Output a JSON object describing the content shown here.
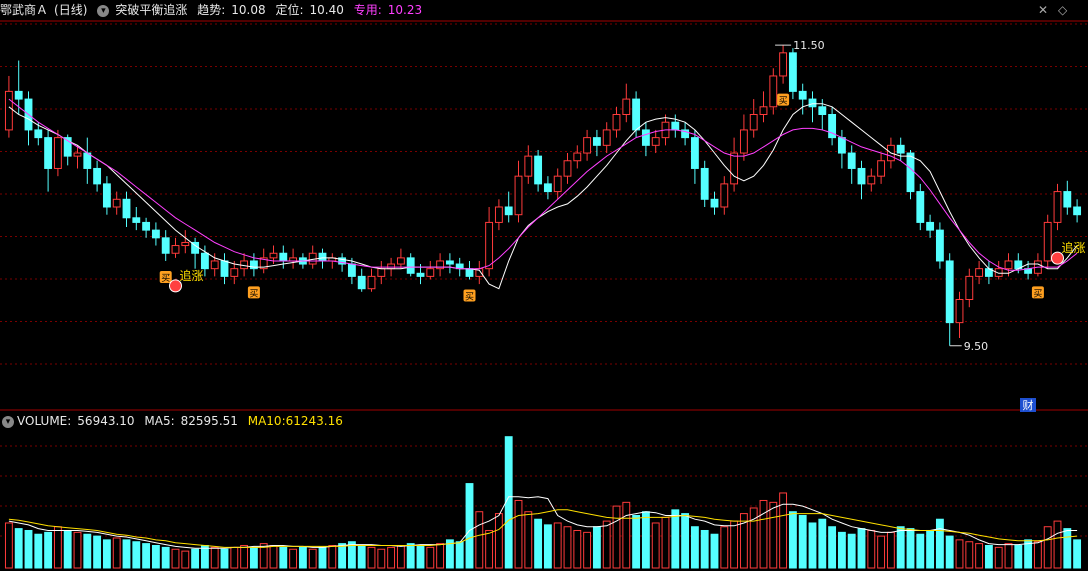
{
  "header": {
    "stock_name": "鄂武商Ａ",
    "period": "(日线)",
    "indicator_name": "突破平衡追涨",
    "trend_label": "趋势:",
    "trend_value": "10.08",
    "position_label": "定位:",
    "position_value": "10.40",
    "special_label": "专用:",
    "special_value": "10.23"
  },
  "volume_header": {
    "volume_label": "VOLUME:",
    "volume_value": "56943.10",
    "ma5_label": "MA5:",
    "ma5_value": "82595.51",
    "ma10_label": "MA10:",
    "ma10_value": "61243.16"
  },
  "annotations": {
    "high_label": "11.50",
    "low_label": "9.50",
    "signal_chase": "追涨",
    "signal_buy": "买",
    "badge_finance": "财"
  },
  "colors": {
    "up": "#ff3b3b",
    "down": "#54ffff",
    "ma_white": "#ffffff",
    "ma_magenta": "#ff40ff",
    "ma_yellow": "#ffe000",
    "grid": "#7a0000",
    "signal_chase": "#ffe000",
    "signal_buy": "#ffa020"
  },
  "chart_data": {
    "type": "candlestick",
    "price_range": [
      9.25,
      11.65
    ],
    "candles": [
      [
        10.95,
        11.2,
        11.3,
        10.9
      ],
      [
        11.2,
        11.15,
        11.4,
        11.05
      ],
      [
        11.15,
        10.95,
        11.2,
        10.85
      ],
      [
        10.95,
        10.9,
        11.0,
        10.85
      ],
      [
        10.9,
        10.7,
        10.95,
        10.55
      ],
      [
        10.7,
        10.9,
        10.95,
        10.65
      ],
      [
        10.9,
        10.78,
        10.92,
        10.72
      ],
      [
        10.78,
        10.8,
        10.85,
        10.7
      ],
      [
        10.8,
        10.7,
        10.9,
        10.6
      ],
      [
        10.7,
        10.6,
        10.75,
        10.55
      ],
      [
        10.6,
        10.45,
        10.65,
        10.4
      ],
      [
        10.45,
        10.5,
        10.55,
        10.4
      ],
      [
        10.5,
        10.38,
        10.55,
        10.32
      ],
      [
        10.38,
        10.35,
        10.45,
        10.3
      ],
      [
        10.35,
        10.3,
        10.38,
        10.25
      ],
      [
        10.3,
        10.25,
        10.35,
        10.2
      ],
      [
        10.25,
        10.15,
        10.3,
        10.1
      ],
      [
        10.15,
        10.2,
        10.25,
        10.12
      ],
      [
        10.2,
        10.22,
        10.3,
        10.15
      ],
      [
        10.22,
        10.15,
        10.25,
        10.05
      ],
      [
        10.15,
        10.05,
        10.2,
        10.0
      ],
      [
        10.05,
        10.1,
        10.15,
        10.0
      ],
      [
        10.1,
        10.0,
        10.15,
        9.95
      ],
      [
        10.0,
        10.05,
        10.1,
        9.95
      ],
      [
        10.05,
        10.1,
        10.15,
        10.0
      ],
      [
        10.1,
        10.05,
        10.15,
        10.0
      ],
      [
        10.05,
        10.12,
        10.18,
        10.02
      ],
      [
        10.12,
        10.15,
        10.2,
        10.08
      ],
      [
        10.15,
        10.1,
        10.2,
        10.05
      ],
      [
        10.1,
        10.12,
        10.18,
        10.05
      ],
      [
        10.12,
        10.08,
        10.15,
        10.05
      ],
      [
        10.08,
        10.15,
        10.2,
        10.05
      ],
      [
        10.15,
        10.1,
        10.18,
        10.05
      ],
      [
        10.1,
        10.12,
        10.15,
        10.05
      ],
      [
        10.12,
        10.08,
        10.15,
        10.03
      ],
      [
        10.08,
        10.0,
        10.12,
        9.95
      ],
      [
        10.0,
        9.92,
        10.05,
        9.9
      ],
      [
        9.92,
        10.0,
        10.05,
        9.9
      ],
      [
        10.0,
        10.05,
        10.1,
        9.95
      ],
      [
        10.05,
        10.08,
        10.12,
        10.0
      ],
      [
        10.08,
        10.12,
        10.18,
        10.05
      ],
      [
        10.12,
        10.02,
        10.15,
        10.0
      ],
      [
        10.02,
        10.0,
        10.08,
        9.95
      ],
      [
        10.0,
        10.05,
        10.1,
        9.98
      ],
      [
        10.05,
        10.1,
        10.15,
        10.0
      ],
      [
        10.1,
        10.08,
        10.15,
        10.02
      ],
      [
        10.08,
        10.05,
        10.12,
        10.0
      ],
      [
        10.05,
        10.0,
        10.1,
        9.98
      ],
      [
        10.0,
        10.05,
        10.1,
        9.95
      ],
      [
        10.05,
        10.35,
        10.45,
        10.0
      ],
      [
        10.35,
        10.45,
        10.5,
        10.3
      ],
      [
        10.45,
        10.4,
        10.55,
        10.35
      ],
      [
        10.4,
        10.65,
        10.75,
        10.35
      ],
      [
        10.65,
        10.78,
        10.85,
        10.6
      ],
      [
        10.78,
        10.6,
        10.82,
        10.55
      ],
      [
        10.6,
        10.55,
        10.65,
        10.5
      ],
      [
        10.55,
        10.65,
        10.7,
        10.5
      ],
      [
        10.65,
        10.75,
        10.8,
        10.6
      ],
      [
        10.75,
        10.8,
        10.85,
        10.7
      ],
      [
        10.8,
        10.9,
        10.95,
        10.75
      ],
      [
        10.9,
        10.85,
        10.95,
        10.78
      ],
      [
        10.85,
        10.95,
        11.0,
        10.8
      ],
      [
        10.95,
        11.05,
        11.1,
        10.9
      ],
      [
        11.05,
        11.15,
        11.25,
        11.0
      ],
      [
        11.15,
        10.95,
        11.2,
        10.9
      ],
      [
        10.95,
        10.85,
        11.0,
        10.78
      ],
      [
        10.85,
        10.9,
        10.95,
        10.8
      ],
      [
        10.9,
        11.0,
        11.05,
        10.85
      ],
      [
        11.0,
        10.95,
        11.05,
        10.9
      ],
      [
        10.95,
        10.9,
        11.0,
        10.85
      ],
      [
        10.9,
        10.7,
        10.95,
        10.6
      ],
      [
        10.7,
        10.5,
        10.75,
        10.45
      ],
      [
        10.5,
        10.45,
        10.55,
        10.4
      ],
      [
        10.45,
        10.6,
        10.65,
        10.4
      ],
      [
        10.6,
        10.8,
        10.9,
        10.55
      ],
      [
        10.8,
        10.95,
        11.05,
        10.75
      ],
      [
        10.95,
        11.05,
        11.15,
        10.9
      ],
      [
        11.05,
        11.1,
        11.2,
        11.0
      ],
      [
        11.1,
        11.3,
        11.35,
        11.05
      ],
      [
        11.3,
        11.45,
        11.5,
        11.25
      ],
      [
        11.45,
        11.2,
        11.48,
        11.15
      ],
      [
        11.2,
        11.15,
        11.25,
        11.05
      ],
      [
        11.15,
        11.1,
        11.2,
        11.0
      ],
      [
        11.1,
        11.05,
        11.15,
        10.95
      ],
      [
        11.05,
        10.9,
        11.1,
        10.85
      ],
      [
        10.9,
        10.8,
        10.95,
        10.7
      ],
      [
        10.8,
        10.7,
        10.85,
        10.6
      ],
      [
        10.7,
        10.6,
        10.75,
        10.5
      ],
      [
        10.6,
        10.65,
        10.7,
        10.55
      ],
      [
        10.65,
        10.75,
        10.8,
        10.6
      ],
      [
        10.75,
        10.85,
        10.9,
        10.7
      ],
      [
        10.85,
        10.8,
        10.9,
        10.75
      ],
      [
        10.8,
        10.55,
        10.82,
        10.5
      ],
      [
        10.55,
        10.35,
        10.6,
        10.3
      ],
      [
        10.35,
        10.3,
        10.4,
        10.25
      ],
      [
        10.3,
        10.1,
        10.35,
        10.05
      ],
      [
        10.1,
        9.7,
        10.15,
        9.55
      ],
      [
        9.7,
        9.85,
        9.9,
        9.6
      ],
      [
        9.85,
        10.0,
        10.05,
        9.8
      ],
      [
        10.0,
        10.05,
        10.1,
        9.95
      ],
      [
        10.05,
        10.0,
        10.1,
        9.95
      ],
      [
        10.0,
        10.05,
        10.1,
        9.98
      ],
      [
        10.05,
        10.1,
        10.15,
        10.0
      ],
      [
        10.1,
        10.05,
        10.15,
        10.02
      ],
      [
        10.05,
        10.02,
        10.1,
        9.98
      ],
      [
        10.02,
        10.1,
        10.15,
        10.0
      ],
      [
        10.1,
        10.35,
        10.4,
        10.05
      ],
      [
        10.35,
        10.55,
        10.6,
        10.3
      ],
      [
        10.55,
        10.45,
        10.62,
        10.4
      ],
      [
        10.45,
        10.4,
        10.5,
        10.35
      ]
    ],
    "ma_white": [
      11.1,
      11.05,
      11.02,
      10.98,
      10.95,
      10.92,
      10.88,
      10.85,
      10.8,
      10.76,
      10.72,
      10.66,
      10.6,
      10.54,
      10.48,
      10.42,
      10.36,
      10.3,
      10.25,
      10.2,
      10.16,
      10.12,
      10.1,
      10.08,
      10.07,
      10.06,
      10.06,
      10.07,
      10.08,
      10.09,
      10.1,
      10.11,
      10.12,
      10.12,
      10.11,
      10.1,
      10.08,
      10.06,
      10.05,
      10.05,
      10.05,
      10.06,
      10.06,
      10.06,
      10.06,
      10.06,
      10.05,
      10.05,
      10.04,
      9.95,
      9.92,
      10.1,
      10.25,
      10.33,
      10.38,
      10.42,
      10.45,
      10.47,
      10.52,
      10.58,
      10.65,
      10.72,
      10.8,
      10.88,
      10.95,
      11.0,
      11.02,
      11.03,
      11.02,
      11.0,
      10.95,
      10.88,
      10.8,
      10.72,
      10.65,
      10.62,
      10.65,
      10.72,
      10.82,
      10.95,
      11.05,
      11.1,
      11.12,
      11.12,
      11.1,
      11.05,
      11.0,
      10.95,
      10.9,
      10.85,
      10.8,
      10.78,
      10.78,
      10.75,
      10.68,
      10.55,
      10.42,
      10.3,
      10.2,
      10.12,
      10.05,
      10.02,
      10.02,
      10.05,
      10.08,
      10.08,
      10.05,
      10.05,
      10.12,
      10.2
    ],
    "ma_magenta": [
      11.15,
      11.1,
      11.05,
      11.0,
      10.96,
      10.92,
      10.88,
      10.84,
      10.8,
      10.76,
      10.72,
      10.68,
      10.63,
      10.58,
      10.53,
      10.48,
      10.43,
      10.38,
      10.34,
      10.3,
      10.26,
      10.22,
      10.19,
      10.16,
      10.14,
      10.12,
      10.11,
      10.1,
      10.1,
      10.1,
      10.1,
      10.1,
      10.1,
      10.1,
      10.09,
      10.08,
      10.07,
      10.06,
      10.06,
      10.06,
      10.06,
      10.06,
      10.06,
      10.06,
      10.06,
      10.06,
      10.05,
      10.05,
      10.05,
      10.07,
      10.12,
      10.18,
      10.25,
      10.32,
      10.38,
      10.44,
      10.5,
      10.56,
      10.62,
      10.68,
      10.73,
      10.78,
      10.82,
      10.86,
      10.9,
      10.92,
      10.94,
      10.95,
      10.95,
      10.94,
      10.92,
      10.88,
      10.84,
      10.8,
      10.78,
      10.78,
      10.8,
      10.84,
      10.88,
      10.92,
      10.95,
      10.96,
      10.96,
      10.95,
      10.93,
      10.9,
      10.87,
      10.84,
      10.82,
      10.8,
      10.78,
      10.75,
      10.7,
      10.64,
      10.56,
      10.47,
      10.38,
      10.3,
      10.22,
      10.15,
      10.1,
      10.06,
      10.04,
      10.04,
      10.05,
      10.06,
      10.06,
      10.06,
      10.1,
      10.15
    ],
    "volumes": [
      48000,
      42000,
      40000,
      36000,
      38000,
      44000,
      40000,
      38000,
      36000,
      34000,
      30000,
      32000,
      30000,
      28000,
      26000,
      24000,
      22000,
      20000,
      18000,
      20000,
      24000,
      22000,
      20000,
      22000,
      24000,
      22000,
      26000,
      24000,
      22000,
      20000,
      22000,
      20000,
      22000,
      24000,
      26000,
      28000,
      24000,
      22000,
      20000,
      22000,
      24000,
      26000,
      24000,
      22000,
      26000,
      30000,
      28000,
      90000,
      60000,
      40000,
      58000,
      140000,
      72000,
      60000,
      52000,
      46000,
      48000,
      44000,
      40000,
      38000,
      44000,
      50000,
      66000,
      70000,
      56000,
      60000,
      48000,
      54000,
      62000,
      58000,
      44000,
      40000,
      36000,
      44000,
      50000,
      58000,
      64000,
      72000,
      70000,
      80000,
      60000,
      56000,
      48000,
      52000,
      44000,
      38000,
      36000,
      42000,
      40000,
      34000,
      38000,
      44000,
      42000,
      36000,
      40000,
      52000,
      34000,
      30000,
      28000,
      26000,
      24000,
      22000,
      26000,
      24000,
      30000,
      28000,
      44000,
      50000,
      42000,
      30000
    ],
    "vol_ma5": [
      50000,
      48000,
      46000,
      42000,
      40000,
      40000,
      40000,
      40000,
      39000,
      38000,
      36000,
      34000,
      33000,
      31000,
      29000,
      27000,
      25000,
      23000,
      22000,
      21000,
      21000,
      21000,
      21000,
      22000,
      22000,
      23000,
      23000,
      24000,
      24000,
      23000,
      23000,
      22000,
      22000,
      23000,
      24000,
      25000,
      25000,
      25000,
      24000,
      24000,
      23000,
      24000,
      25000,
      25000,
      25000,
      26000,
      27000,
      40000,
      46000,
      50000,
      56000,
      76000,
      76000,
      75000,
      76000,
      74000,
      56000,
      50000,
      46000,
      44000,
      44000,
      45000,
      50000,
      56000,
      58000,
      60000,
      59000,
      56000,
      56000,
      56000,
      52000,
      50000,
      46000,
      45000,
      45000,
      48000,
      52000,
      58000,
      64000,
      68000,
      68000,
      66000,
      62000,
      58000,
      52000,
      48000,
      44000,
      42000,
      40000,
      38000,
      38000,
      40000,
      40000,
      40000,
      40000,
      42000,
      40000,
      38000,
      35000,
      30000,
      26000,
      25000,
      25000,
      25000,
      26000,
      27000,
      31000,
      37000,
      40000,
      40000
    ],
    "vol_ma10": [
      52000,
      51000,
      49000,
      47000,
      45000,
      44000,
      43000,
      42000,
      41000,
      40000,
      38000,
      36000,
      35000,
      33000,
      32000,
      30000,
      29000,
      27000,
      26000,
      25000,
      24000,
      23000,
      22000,
      22000,
      22000,
      22000,
      22000,
      23000,
      23000,
      23000,
      23000,
      23000,
      23000,
      23000,
      23000,
      24000,
      24000,
      24000,
      24000,
      24000,
      24000,
      24000,
      24000,
      24000,
      25000,
      26000,
      27000,
      32000,
      35000,
      37000,
      41000,
      51000,
      56000,
      57000,
      58000,
      60000,
      62000,
      62000,
      60000,
      58000,
      56000,
      54000,
      53000,
      53000,
      53000,
      54000,
      54000,
      54000,
      55000,
      56000,
      55000,
      54000,
      52000,
      51000,
      50000,
      50000,
      50000,
      52000,
      54000,
      56000,
      58000,
      58000,
      58000,
      58000,
      56000,
      54000,
      52000,
      50000,
      48000,
      46000,
      44000,
      42000,
      41000,
      40000,
      40000,
      40000,
      39000,
      38000,
      37000,
      35000,
      33000,
      31000,
      30000,
      29000,
      29000,
      29000,
      30000,
      32000,
      33000,
      34000
    ],
    "vol_range": [
      0,
      145000
    ],
    "signals": [
      {
        "type": "buy",
        "index": 16
      },
      {
        "type": "chase",
        "index": 17
      },
      {
        "type": "buy",
        "index": 25
      },
      {
        "type": "buy",
        "index": 47
      },
      {
        "type": "buy",
        "index": 79
      },
      {
        "type": "buy",
        "index": 105
      },
      {
        "type": "chase",
        "index": 107
      }
    ],
    "high_index": 79,
    "low_index": 96,
    "xlabel": "",
    "ylabel": ""
  }
}
